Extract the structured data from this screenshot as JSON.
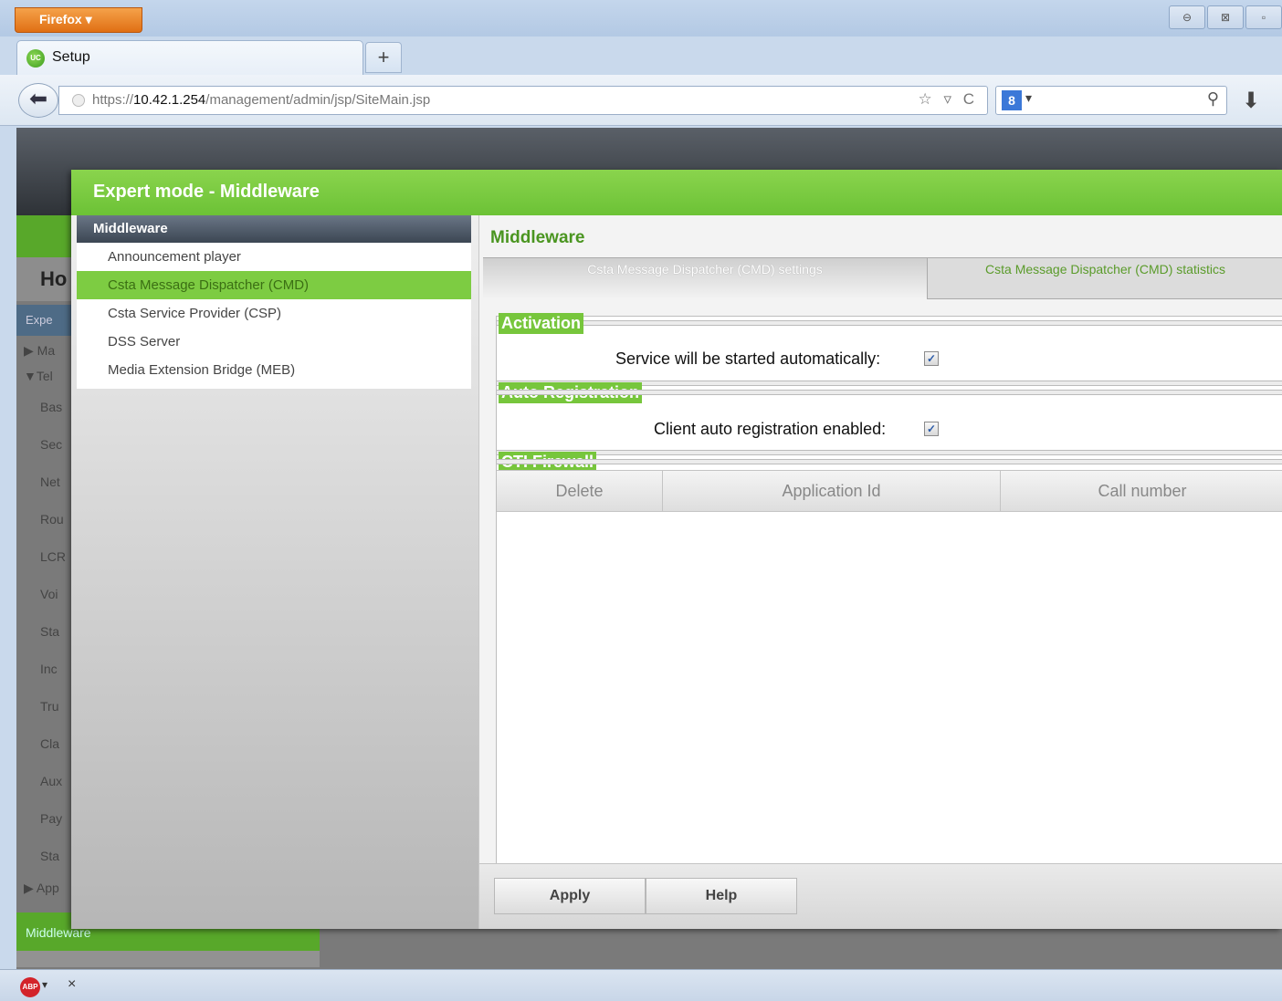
{
  "browser": {
    "menu_label": "Firefox ▾",
    "window_controls": [
      "⊖",
      "⊠",
      "▫"
    ],
    "tab_title": "Setup",
    "tab_favicon_text": "UC",
    "new_tab": "+",
    "back_glyph": "⬅",
    "url_prefix": "https://",
    "url_host": "10.42.1.254",
    "url_path": "/management/admin/jsp/SiteMain.jsp",
    "url_icons": "☆ ▿ C",
    "search_engine_letter": "8",
    "search_caret": "▾",
    "search_go": "⚲",
    "download": "⬇"
  },
  "page": {
    "home_label": "Ho",
    "expert_label": "Expe",
    "nav_items": [
      "▶ Ma",
      "▼Tel",
      "Bas",
      "Sec",
      "Net",
      "Rou",
      "LCR",
      "Voi",
      "Sta",
      "Inc",
      "Tru",
      "Cla",
      "Aux",
      "Pay",
      "Sta",
      "▶ App"
    ],
    "middleware_strip": "Middleware"
  },
  "dialog": {
    "title": "Expert mode - Middleware",
    "left_header": "Middleware",
    "left_items": [
      {
        "label": "Announcement player"
      },
      {
        "label": "Csta Message Dispatcher (CMD)"
      },
      {
        "label": "Csta Service Provider (CSP)"
      },
      {
        "label": "DSS Server"
      },
      {
        "label": "Media Extension Bridge (MEB)"
      }
    ],
    "right_title": "Middleware",
    "tabs": [
      {
        "label": "Csta Message Dispatcher (CMD) settings"
      },
      {
        "label": "Csta Message Dispatcher (CMD) statistics"
      }
    ],
    "activation": {
      "legend": "Activation",
      "label": "Service will be started automatically:",
      "checked_glyph": "✓"
    },
    "auto_registration": {
      "legend": "Auto Registration",
      "label": "Client auto registration enabled:",
      "checked_glyph": "✓"
    },
    "cti_firewall": {
      "legend": "CTI Firewall",
      "columns": [
        "Delete",
        "Application Id",
        "Call number"
      ]
    },
    "buttons": {
      "apply": "Apply",
      "help": "Help"
    }
  },
  "statusbar": {
    "abp_text": "ABP",
    "caret": "▾",
    "close": "×"
  }
}
